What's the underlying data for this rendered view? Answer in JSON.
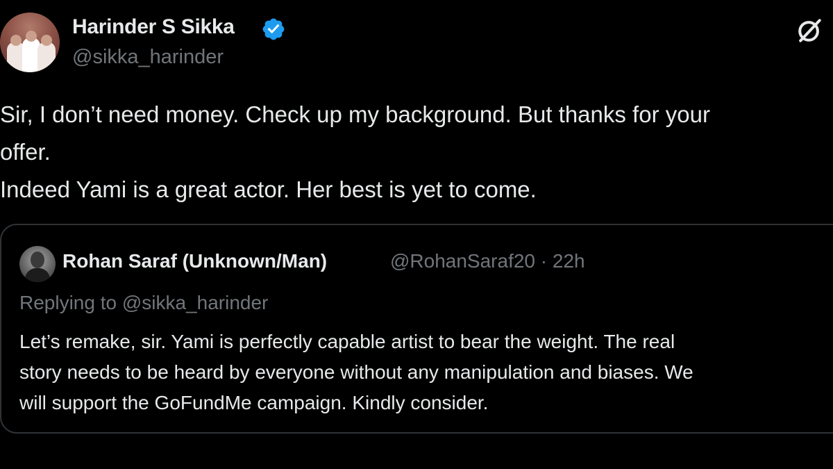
{
  "author": {
    "display_name": "Harinder S Sikka",
    "handle": "@sikka_harinder",
    "verified": true,
    "verified_color": "#1d9bf0"
  },
  "icons": {
    "verified": "verified-badge-icon",
    "grok": "grok-slash-icon"
  },
  "tweet": {
    "lines": [
      "Sir, I don’t need money. Check up my background. But thanks for your",
      "offer.",
      "Indeed Yami is a great actor.  Her best is yet to come."
    ]
  },
  "quote": {
    "display_name": "Rohan Saraf (Unknown/Man)",
    "meta": "@RohanSaraf20 · 22h",
    "replying_to": "Replying to @sikka_harinder",
    "lines": [
      "Let’s remake, sir. Yami is perfectly capable artist to bear the weight. The real",
      "story needs to be heard by everyone without any manipulation and biases. We",
      "will support the GoFundMe campaign. Kindly consider."
    ]
  },
  "colors": {
    "background": "#000000",
    "text_primary": "#e7e9ea",
    "text_secondary": "#71767b",
    "border": "#2f3336"
  }
}
